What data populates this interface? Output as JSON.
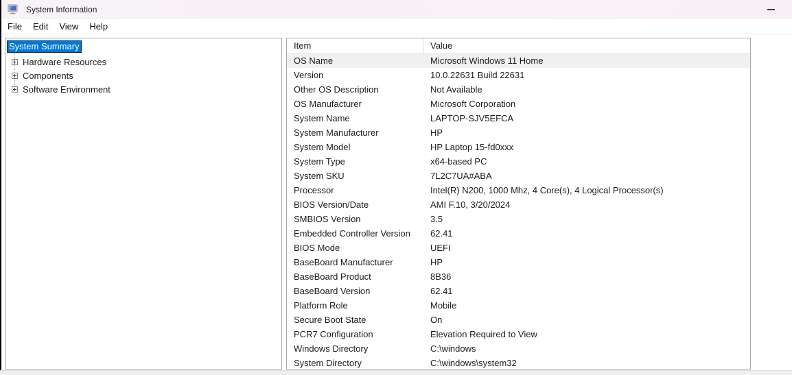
{
  "window": {
    "title": "System Information",
    "minimize_tooltip": "Minimize"
  },
  "menu": {
    "items": [
      "File",
      "Edit",
      "View",
      "Help"
    ]
  },
  "tree": {
    "selected_item": "System Summary",
    "items": [
      {
        "label": "Hardware Resources",
        "expanded": false
      },
      {
        "label": "Components",
        "expanded": false
      },
      {
        "label": "Software Environment",
        "expanded": false
      }
    ]
  },
  "table": {
    "columns": [
      "Item",
      "Value"
    ],
    "rows": [
      {
        "item": "OS Name",
        "value": "Microsoft Windows 11 Home",
        "highlighted": true
      },
      {
        "item": "Version",
        "value": "10.0.22631 Build 22631",
        "highlighted": false
      },
      {
        "item": "Other OS Description",
        "value": "Not Available",
        "highlighted": false
      },
      {
        "item": "OS Manufacturer",
        "value": "Microsoft Corporation",
        "highlighted": false
      },
      {
        "item": "System Name",
        "value": "LAPTOP-SJV5EFCA",
        "highlighted": false
      },
      {
        "item": "System Manufacturer",
        "value": "HP",
        "highlighted": false
      },
      {
        "item": "System Model",
        "value": "HP Laptop 15-fd0xxx",
        "highlighted": false
      },
      {
        "item": "System Type",
        "value": "x64-based PC",
        "highlighted": false
      },
      {
        "item": "System SKU",
        "value": "7L2C7UA#ABA",
        "highlighted": false
      },
      {
        "item": "Processor",
        "value": "Intel(R) N200, 1000 Mhz, 4 Core(s), 4 Logical Processor(s)",
        "highlighted": false
      },
      {
        "item": "BIOS Version/Date",
        "value": "AMI F.10, 3/20/2024",
        "highlighted": false
      },
      {
        "item": "SMBIOS Version",
        "value": "3.5",
        "highlighted": false
      },
      {
        "item": "Embedded Controller Version",
        "value": "62.41",
        "highlighted": false
      },
      {
        "item": "BIOS Mode",
        "value": "UEFI",
        "highlighted": false
      },
      {
        "item": "BaseBoard Manufacturer",
        "value": "HP",
        "highlighted": false
      },
      {
        "item": "BaseBoard Product",
        "value": "8B36",
        "highlighted": false
      },
      {
        "item": "BaseBoard Version",
        "value": "62.41",
        "highlighted": false
      },
      {
        "item": "Platform Role",
        "value": "Mobile",
        "highlighted": false
      },
      {
        "item": "Secure Boot State",
        "value": "On",
        "highlighted": false
      },
      {
        "item": "PCR7 Configuration",
        "value": "Elevation Required to View",
        "highlighted": false
      },
      {
        "item": "Windows Directory",
        "value": "C:\\windows",
        "highlighted": false
      },
      {
        "item": "System Directory",
        "value": "C:\\windows\\system32",
        "highlighted": false
      }
    ]
  },
  "colors": {
    "selection_blue": "#0078d7",
    "titlebar": "#f8f3f8",
    "row_highlight": "#f0f0f0",
    "panel_border": "#a9a9a9"
  }
}
